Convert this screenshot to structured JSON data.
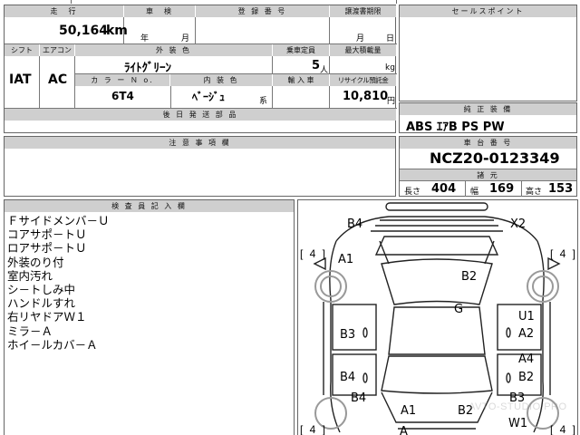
{
  "headers": {
    "mileage": "走　行",
    "inspection": "車　検",
    "registration_no": "登 録 番 号",
    "transfer_deadline": "譲渡書期限",
    "sales_point": "セールスポイント",
    "shift": "シフト",
    "aircon": "エアコン",
    "exterior_color": "外 装 色",
    "capacity": "乗車定員",
    "max_load": "最大積載量",
    "color_no": "カ ラ ー Ｎ o.",
    "interior_color": "内 装 色",
    "import": "輸 入 車",
    "recycle_fee": "リサイクル預託金",
    "later_docs": "後 日 発 送 部 品",
    "equipment": "純 正 装 備",
    "caution": "注 意 事 項 欄",
    "chassis_no": "車 台 番 号",
    "specs": "諸 元",
    "inspector_notes": "検 査 員 記 入 欄"
  },
  "vehicle": {
    "mileage": "50,164",
    "mileage_unit": "km",
    "inspection_year_unit": "年",
    "inspection_month_unit": "月",
    "deadline_month_unit": "月",
    "deadline_day_unit": "日",
    "shift": "IAT",
    "aircon": "AC",
    "exterior_color": "ﾗｲﾄｸﾞﾘｰﾝ",
    "capacity": "5",
    "capacity_unit": "人",
    "max_load_unit": "kg",
    "color_no": "6T4",
    "interior_color": "ﾍﾞｰｼﾞｭ",
    "interior_color_suffix": "系",
    "recycle_fee": "10,810",
    "recycle_unit": "円",
    "equipment": "ABS ｴｱB PS PW",
    "chassis_no": "NCZ20-0123349",
    "length_label": "長さ",
    "length": "404",
    "width_label": "幅",
    "width": "169",
    "height_label": "高さ",
    "height": "153"
  },
  "inspector_notes": [
    "Ｆサイドメンバ－Ｕ",
    "コアサポ－トＵ",
    "ロアサポ－トＵ",
    "外装のり付",
    "室内汚れ",
    "シ－トしみ中",
    "ハンドルすれ",
    "右リヤドアＷ１",
    "ミラ－Ａ",
    "ホイ－ルカバ－Ａ"
  ],
  "damage_map": {
    "tire_label": "[ 4 ]",
    "marks": {
      "front_left_top": "B4",
      "front_right_top": "X2",
      "left_front_fender": "A1",
      "hood": "B2",
      "roof": "G",
      "right_front_door_upper": "U1",
      "right_front_door": "A2",
      "left_front_door": "B3",
      "right_rear_door_upper": "A4",
      "right_rear_door": "B2",
      "left_rear_door": "B4",
      "left_rear_quarter": "B4",
      "right_rear_quarter": "B3",
      "rear_left": "A1",
      "rear_right": "B2",
      "rear_right_lower": "W1",
      "rear_center": "A"
    }
  },
  "watermark": "AVTO-STUDIO.PRO"
}
